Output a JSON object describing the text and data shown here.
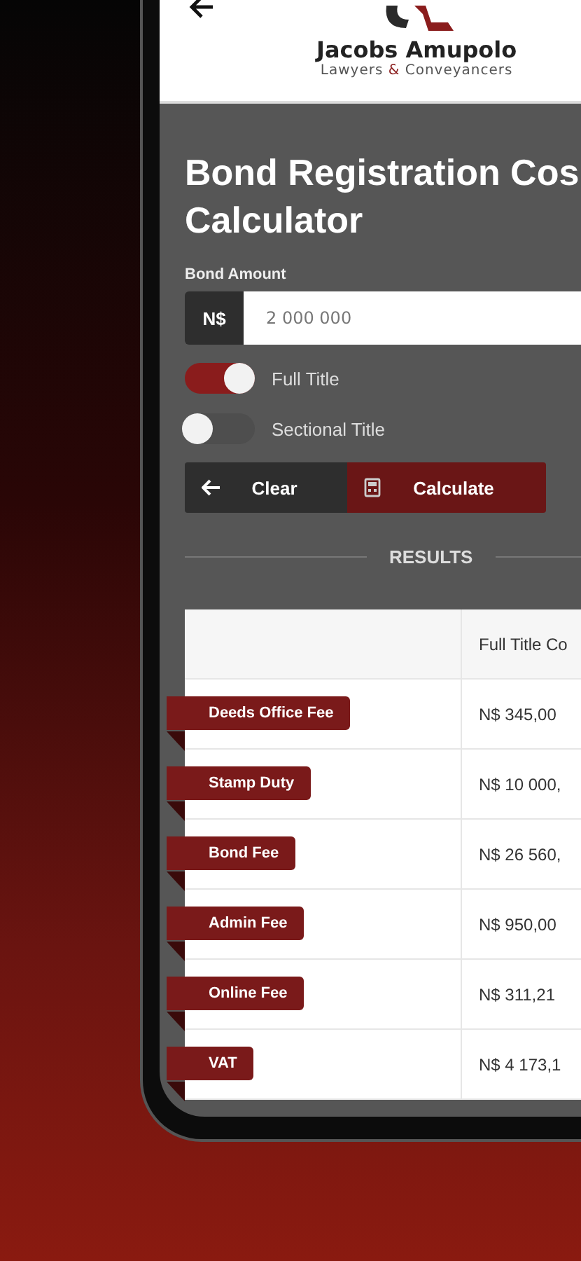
{
  "header": {
    "brand": "Jacobs Amupolo",
    "tagline": {
      "before": "Lawyers",
      "mark": "&",
      "after": "Conveyancers"
    }
  },
  "title_lines": [
    "Bond Registration Cos",
    "Calculator"
  ],
  "bond_amount": {
    "label": "Bond Amount",
    "prefix": "N$",
    "value": "2 000 000"
  },
  "options": [
    {
      "label": "Full Title",
      "on": true
    },
    {
      "label": "Sectional Title",
      "on": false
    }
  ],
  "buttons": [
    {
      "kind": "clear",
      "label": "Clear"
    },
    {
      "kind": "calculate",
      "label": "Calculate"
    }
  ],
  "results_heading": "RESULTS",
  "table": {
    "column_2": "Full Title Co",
    "rows": [
      {
        "fee": "Deeds Office Fee",
        "amount": "N$ 345,00"
      },
      {
        "fee": "Stamp Duty",
        "amount": "N$ 10 000,"
      },
      {
        "fee": "Bond Fee",
        "amount": "N$ 26 560,"
      },
      {
        "fee": "Admin Fee",
        "amount": "N$ 950,00"
      },
      {
        "fee": "Online Fee",
        "amount": "N$ 311,21"
      },
      {
        "fee": "VAT",
        "amount": "N$ 4 173,1"
      }
    ]
  }
}
